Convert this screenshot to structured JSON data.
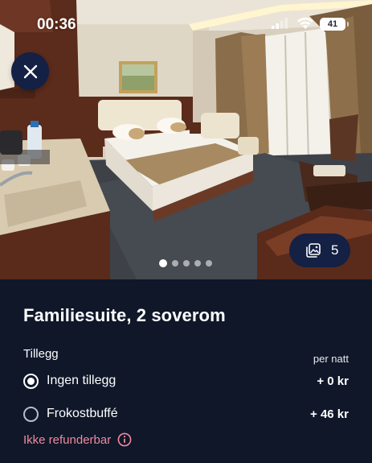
{
  "status_bar": {
    "time": "00:36",
    "battery": "41"
  },
  "photo": {
    "description_icon": "hotel-room-photo",
    "gallery_count": "5",
    "page_dots": {
      "total": 5,
      "active_index": 0
    }
  },
  "room": {
    "title": "Familiesuite, 2 soverom"
  },
  "addons": {
    "label": "Tillegg",
    "price_unit": "per natt",
    "options": [
      {
        "label": "Ingen tillegg",
        "price": "+ 0 kr",
        "selected": true
      },
      {
        "label": "Frokostbuffé",
        "price": "+ 46 kr",
        "selected": false
      }
    ]
  },
  "refund": {
    "label": "Ikke refunderbar"
  },
  "colors": {
    "panel_bg": "#0f1729",
    "button_bg": "#142044",
    "refund_text": "#f08a9c"
  }
}
